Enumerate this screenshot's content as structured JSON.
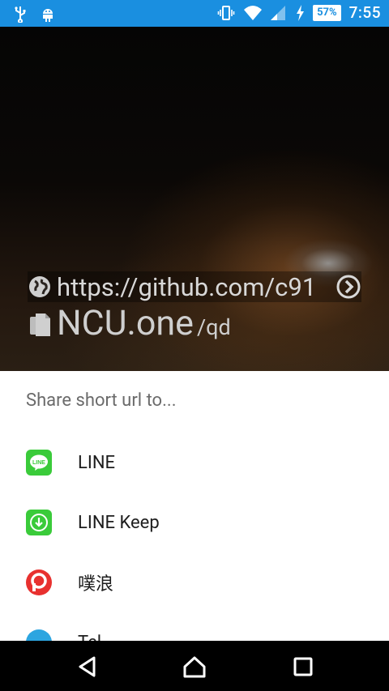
{
  "status_bar": {
    "battery": "57%",
    "time": "7:55"
  },
  "hero": {
    "long_url": "https://github.com/c91",
    "short_domain": "NCU.one",
    "short_path": "/qd"
  },
  "share_sheet": {
    "title": "Share short url to...",
    "items": [
      {
        "label": "LINE",
        "icon": "line-icon",
        "color": "#3acb3a"
      },
      {
        "label": "LINE Keep",
        "icon": "line-keep-icon",
        "color": "#3acb3a"
      },
      {
        "label": "噗浪",
        "icon": "plurk-icon",
        "color": "#e8312f"
      },
      {
        "label": "Tel",
        "icon": "telegram-icon",
        "color": "#2ca5e0"
      }
    ]
  },
  "colors": {
    "status_bar": "#1a8fe0",
    "sheet_bg": "#ffffff",
    "navbar": "#000000"
  }
}
